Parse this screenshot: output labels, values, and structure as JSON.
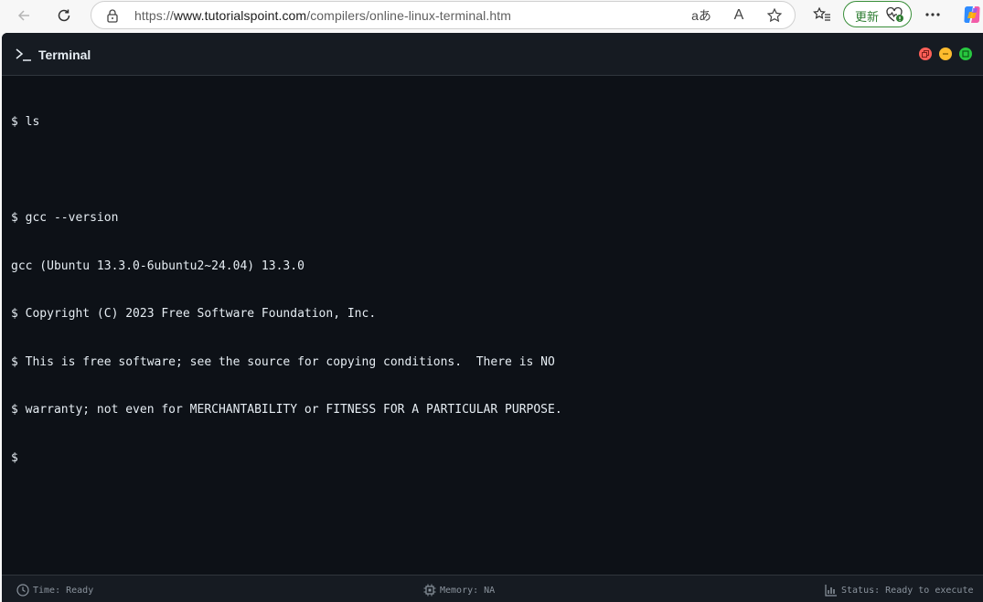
{
  "browser": {
    "url_prefix": "https://",
    "url_host": "www.tutorialspoint.com",
    "url_path": "/compilers/online-linux-terminal.htm",
    "translate_glyph": "aあ",
    "read_aloud_glyph": "A",
    "update_label": "更新"
  },
  "terminal": {
    "title": "Terminal",
    "lines": [
      "$ ls",
      "",
      "$ gcc --version",
      "gcc (Ubuntu 13.3.0-6ubuntu2~24.04) 13.3.0",
      "$ Copyright (C) 2023 Free Software Foundation, Inc.",
      "$ This is free software; see the source for copying conditions.  There is NO",
      "$ warranty; not even for MERCHANTABILITY or FITNESS FOR A PARTICULAR PURPOSE.",
      "$"
    ]
  },
  "status": {
    "time": "Time: Ready",
    "memory": "Memory: NA",
    "status": "Status: Ready to execute"
  },
  "colors": {
    "terminal_bg": "#0d1117",
    "header_bg": "#161b22",
    "close": "#ff5f57",
    "minimize": "#febc2e",
    "maximize": "#28c840"
  },
  "icons": [
    "back-arrow-icon",
    "refresh-icon",
    "lock-icon",
    "translate-icon",
    "read-aloud-icon",
    "favorite-star-icon",
    "favorites-list-icon",
    "heart-pulse-icon",
    "more-icon",
    "copilot-icon",
    "terminal-prompt-icon",
    "clock-icon",
    "cpu-icon",
    "bar-chart-icon"
  ]
}
